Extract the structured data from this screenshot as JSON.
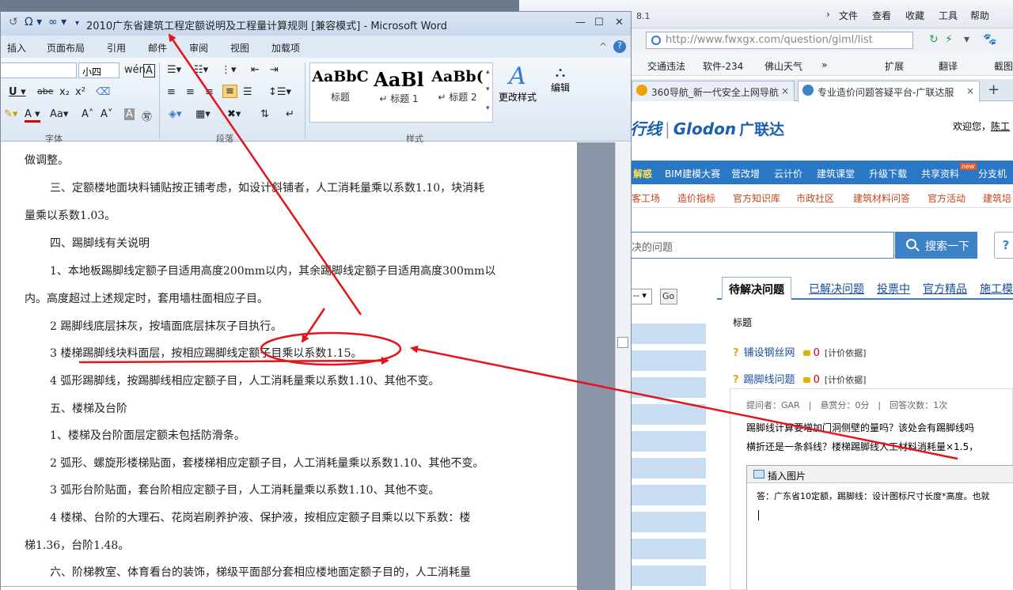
{
  "browser": {
    "ip": "8.1",
    "menu": [
      "文件",
      "查看",
      "收藏",
      "工具",
      "帮助"
    ],
    "url": "http://www.fwxgx.com/question/giml/list",
    "favorites": [
      "交通违法",
      "软件-234",
      "佛山天气",
      "»",
      "扩展",
      "翻译",
      "截图"
    ],
    "tabs": [
      {
        "label": "360导航_新一代安全上网导航",
        "close": "×"
      },
      {
        "label": "专业造价问题答疑平台-广联达服",
        "close": "×"
      }
    ],
    "new_tab": "+"
  },
  "site": {
    "logo_left": "行线",
    "logo_brand": "Glodon",
    "logo_cn": "广联达",
    "welcome": "欢迎您，",
    "user": "陈工",
    "nav1": [
      "解惑",
      "BIM建模大赛",
      "营改增",
      "云计价",
      "建筑课堂",
      "升级下载",
      "共享资料",
      "分支机"
    ],
    "nav_new": "new",
    "nav2": [
      "客工场",
      "造价指标",
      "官方知识库",
      "市政社区",
      "建筑材料问答",
      "官方活动",
      "建筑培"
    ],
    "search_placeholder": "决的问题",
    "search_btn": "搜索一下",
    "help": "?",
    "select_value": "-- ▾",
    "go": "Go",
    "qtabs": [
      "待解决问题",
      "已解决问题",
      "投票中",
      "官方精品",
      "施工模"
    ],
    "th_title": "标题",
    "questions": [
      {
        "title": "铺设钢丝网",
        "score": "0",
        "tag": "[计价依据]"
      },
      {
        "title": "踢脚线问题",
        "score": "0",
        "tag": "[计价依据]"
      }
    ],
    "detail": {
      "meta": "提问者：GAR　|　悬赏分：0分　|　回答次数：1次",
      "body1": "踢脚线计算要增加门洞侧壁的量吗？该处会有踢脚线吗",
      "body2": "横折还是一条斜线？楼梯踢脚线人工材料消耗量×1.5，",
      "editor_toolbar": "插入图片",
      "editor_text": "答：广东省10定额，踢脚线：设计图标尺寸长度*高度。也就"
    }
  },
  "word": {
    "title": "2010广东省建筑工程定额说明及工程量计算规则 [兼容模式] - Microsoft Word",
    "quick_access": [
      "↺",
      "Ω ▾",
      "∞ ▾",
      "▾"
    ],
    "window_btns": [
      "—",
      "☐",
      "✕"
    ],
    "tabs": [
      "插入",
      "页面布局",
      "引用",
      "邮件",
      "审阅",
      "视图",
      "加载项"
    ],
    "font_size": "小四",
    "groups": [
      "字体",
      "段落",
      "样式"
    ],
    "styles": [
      {
        "preview": "AaBbC",
        "name": "标题"
      },
      {
        "preview": "AaBl",
        "name": "↵ 标题 1"
      },
      {
        "preview": "AaBb(",
        "name": "↵ 标题 2"
      }
    ],
    "change_styles": "更改样式",
    "edit": "编辑",
    "lines": [
      "做调整。",
      "三、定额楼地面块料铺贴按正铺考虑，如设计斜铺者，人工消耗量乘以系数1.10，块消耗",
      "量乘以系数1.03。",
      "四、踢脚线有关说明",
      "1、本地板踢脚线定额子目适用高度200mm以内，其余踢脚线定额子目适用高度300mm以",
      "内。高度超过上述规定时，套用墙柱面相应子目。",
      "2 踢脚线底层抹灰，按墙面底层抹灰子目执行。",
      "3 楼梯踢脚线块料面层，按相应踢脚线定额子目乘以系数1.15。",
      "4 弧形踢脚线，按踢脚线相应定额子目，人工消耗量乘以系数1.10、其他不变。",
      "五、楼梯及台阶",
      "1、楼梯及台阶面层定额未包括防滑条。",
      "2 弧形、螺旋形楼梯贴面，套楼梯相应定额子目，人工消耗量乘以系数1.10、其他不变。",
      "3 弧形台阶贴面，套台阶相应定额子目，人工消耗量乘以系数1.10、其他不变。",
      "4 楼梯、台阶的大理石、花岗岩刷养护液、保护液，按相应定额子目乘以以下系数：楼",
      "梯1.36，台阶1.48。",
      "六、阶梯教室、体育看台的装饰，梯级平面部分套相应楼地面定额子目的，人工消耗量"
    ]
  },
  "colors": {
    "annotation": "#e3151a",
    "nav_blue": "#2a78c5",
    "link": "#1a4c9a"
  }
}
